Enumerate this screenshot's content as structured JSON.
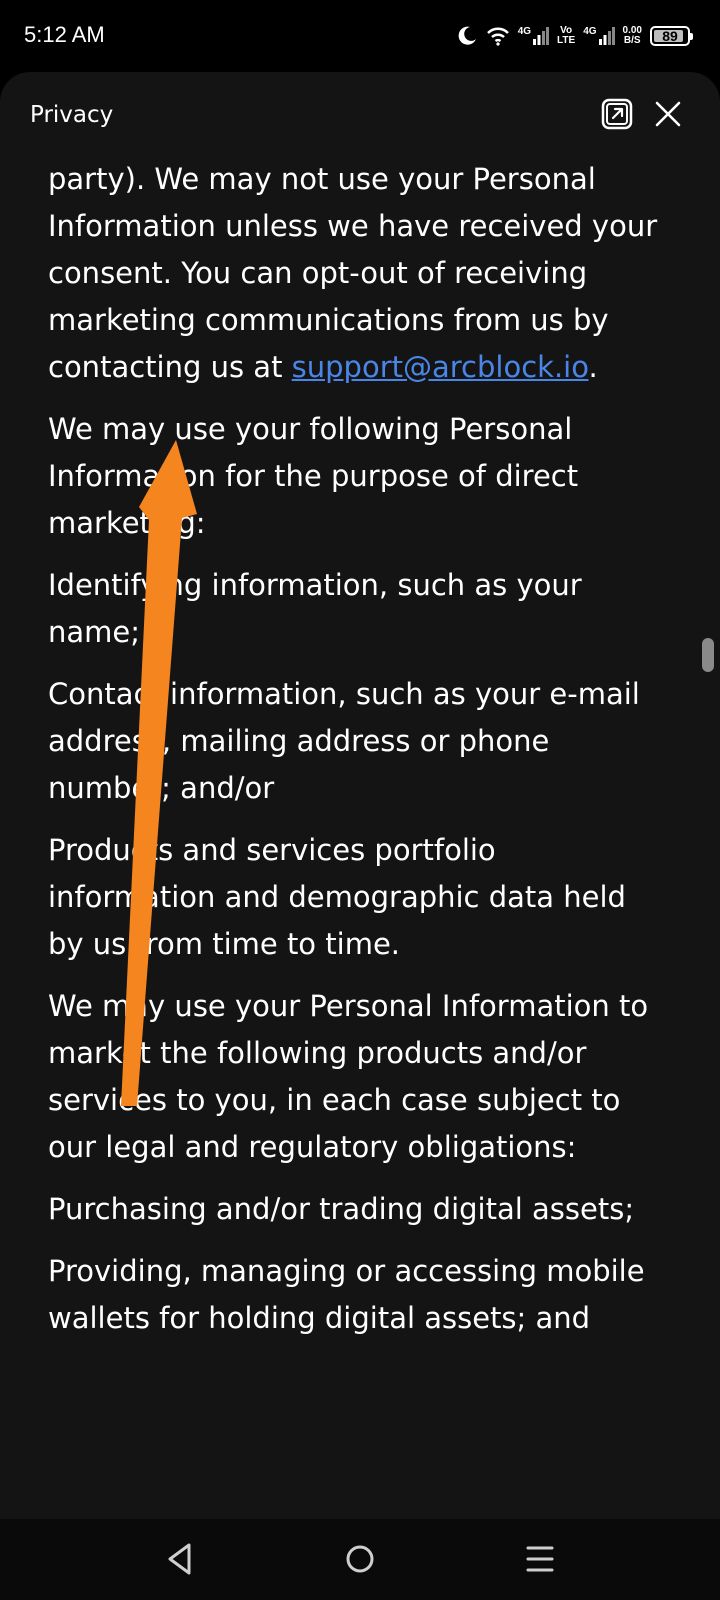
{
  "status_bar": {
    "time": "5:12 AM",
    "network_1": "4G",
    "volte_top": "Vo",
    "volte_bottom": "LTE",
    "network_2": "4G",
    "speed_top": "0.00",
    "speed_bottom": "B/S",
    "battery": "89",
    "icons": [
      "moon-icon",
      "wifi-icon",
      "signal-icon",
      "signal-icon",
      "battery-icon"
    ]
  },
  "sheet": {
    "title": "Privacy",
    "icons": [
      "open-external-icon",
      "close-icon"
    ]
  },
  "content": {
    "p1_text": "party). We may not use your Personal Information unless we have received your consent. You can opt-out of receiving marketing communications from us by contacting us at ",
    "p1_link": "support@arcblock.io",
    "p1_end": ".",
    "p2": "We may use your following Personal Information for the purpose of direct marketing:",
    "p3": "Identifying information, such as your name;",
    "p4": "Contact information, such as your e-mail address, mailing address or phone number; and/or",
    "p5": "Products and services portfolio information and demographic data held by us from time to time.",
    "p6": "We may use your Personal Information to market the following products and/or services to you, in each case subject to our legal and regulatory obligations:",
    "p7": "Purchasing and/or trading digital assets;",
    "p8": "Providing, managing or accessing mobile wallets for holding digital assets; and"
  },
  "annotation_color": "#f5851f",
  "link_color": "#4a86e8",
  "nav_bar": {
    "icons": [
      "back-icon",
      "home-icon",
      "menu-icon"
    ]
  }
}
